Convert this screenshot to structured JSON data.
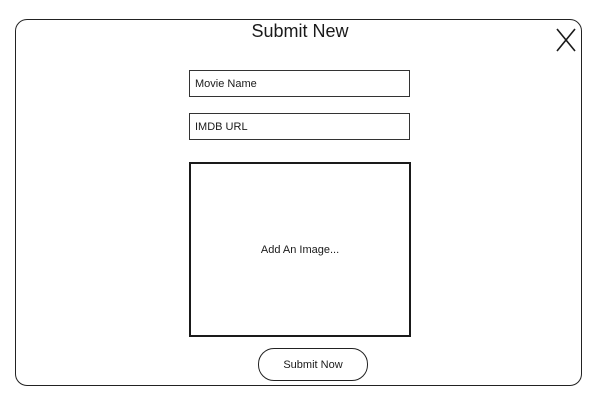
{
  "modal": {
    "title": "Submit New",
    "close_icon": "close-icon"
  },
  "form": {
    "movie_name_placeholder": "Movie Name",
    "imdb_url_placeholder": "IMDB URL",
    "image_dropzone_label": "Add An Image...",
    "submit_label": "Submit Now"
  }
}
